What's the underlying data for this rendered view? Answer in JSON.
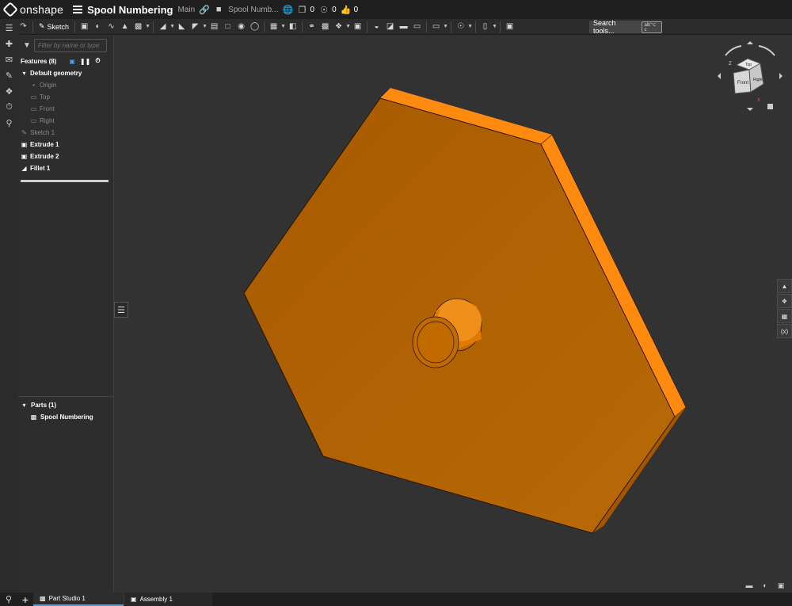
{
  "header": {
    "logo_text": "onshape",
    "doc_title": "Spool Numbering",
    "branch": "Main",
    "folder": "Spool Numb...",
    "versions_count": "0",
    "branches_count": "0",
    "likes_count": "0"
  },
  "toolbar": {
    "sketch_label": "Sketch",
    "search_label": "Search tools...",
    "search_shortcut": "alt/⌥ c"
  },
  "panel": {
    "filter_placeholder": "Filter by name or type",
    "features_label": "Features (8)",
    "default_geometry": "Default geometry",
    "origin": "Origin",
    "top": "Top",
    "front": "Front",
    "right": "Right",
    "sketch1": "Sketch 1",
    "extrude1": "Extrude 1",
    "extrude2": "Extrude 2",
    "fillet1": "Fillet 1",
    "parts_label": "Parts (1)",
    "part_name": "Spool Numbering"
  },
  "viewcube": {
    "top": "Top",
    "front": "Front",
    "right": "Right",
    "axis_z": "Z",
    "axis_x": "X"
  },
  "tabs": {
    "part_studio": "Part Studio 1",
    "assembly": "Assembly 1"
  },
  "colors": {
    "model_face": "#b36200",
    "model_edge": "#ff8c1a",
    "background": "#323232"
  }
}
